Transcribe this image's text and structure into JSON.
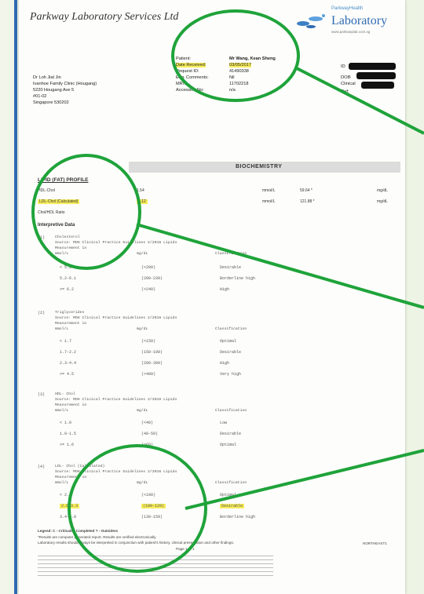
{
  "header": {
    "lab_name": "Parkway Laboratory Services Ltd",
    "logo_small": "ParkwayHealth",
    "logo_big": "Laboratory",
    "logo_url": "www.parkwaylab.com.sg"
  },
  "doctor": {
    "name": "Dr Loh Jiat Jin",
    "clinic": "Ivanhoe Family Clinic (Hougang)",
    "address1": "5220 Hougang Ave 5",
    "address2": "#01-02",
    "address3": "Singapore 530202"
  },
  "patient": {
    "patient_label": "Patient:",
    "patient_value": "Mr Wang, Kean Sheng",
    "received_label": "Date Received:",
    "received_value": "03/05/2017",
    "request_label": "Request ID:",
    "request_value": "41490338",
    "comments_label": "Enq. Comments:",
    "comments_value": "Nil",
    "mrn_label": "MRN:",
    "mrn_value": "11702218",
    "accession_label": "Accession No:",
    "accession_value": "n/a"
  },
  "dob_block": {
    "label1": "ID",
    "label2": "DOB",
    "label3": "Clinical",
    "label4": "Ref:"
  },
  "biochem": {
    "section_title": "BIOCHEMISTRY",
    "panel_title": "LIPID (FAT) PROFILE",
    "rows": [
      {
        "test": "HDL-Chol",
        "value": "1.54",
        "unit": "mmol/L",
        "conv": "59.64 *",
        "conv_unit": "mg/dL"
      },
      {
        "test": "LDL-Chol (Calculated)",
        "value": "3.12",
        "unit": "mmol/L",
        "conv": "121.88 *",
        "conv_unit": "mg/dL"
      },
      {
        "test": "Chol/HDL Ratio",
        "value": "",
        "unit": "",
        "conv": "",
        "conv_unit": ""
      }
    ],
    "interpretive_label": "Interpretive Data"
  },
  "guidelines": [
    {
      "num": "(1)",
      "test": "Cholesterol",
      "source": "Source: MOH Clinical Practice Guidelines 2/2016 Lipids",
      "meas": "Measurement in",
      "unit_header": "mmol/L",
      "mg_header": "mg/dL",
      "cls_header": "Classification",
      "rows": [
        {
          "mmol": "< 5.2",
          "mg": "(<200)",
          "cls": "Desirable"
        },
        {
          "mmol": "5.2-6.1",
          "mg": "(200-239)",
          "cls": "Borderline high"
        },
        {
          "mmol": ">= 6.2",
          "mg": "(>240)",
          "cls": "High"
        }
      ]
    },
    {
      "num": "(2)",
      "test": "Triglycerides",
      "source": "Source: MOH Clinical Practice Guidelines 2/2016 Lipids",
      "meas": "Measurement in",
      "unit_header": "mmol/L",
      "mg_header": "mg/dL",
      "cls_header": "Classification",
      "rows": [
        {
          "mmol": "< 1.7",
          "mg": "(<150)",
          "cls": "Optimal"
        },
        {
          "mmol": "1.7-2.2",
          "mg": "(150-199)",
          "cls": "Desirable"
        },
        {
          "mmol": "2.3-4.4",
          "mg": "(200-399)",
          "cls": "High"
        },
        {
          "mmol": ">= 4.5",
          "mg": "(>400)",
          "cls": "Very high"
        }
      ]
    },
    {
      "num": "(3)",
      "test": "HDL- Chol",
      "source": "Source: MOH Clinical Practice Guidelines 2/2016 Lipids",
      "meas": "Measurement in",
      "unit_header": "mmol/L",
      "mg_header": "mg/dL",
      "cls_header": "Classification",
      "rows": [
        {
          "mmol": "< 1.0",
          "mg": "(<40)",
          "cls": "Low"
        },
        {
          "mmol": "1.0-1.5",
          "mg": "(40-59)",
          "cls": "Desirable"
        },
        {
          "mmol": ">= 1.6",
          "mg": "(>60)",
          "cls": "Optimal"
        }
      ]
    },
    {
      "num": "(4)",
      "test": "LDL- Chol (Calculated)",
      "source": "Source: MOH Clinical Practice Guidelines 2/2016 Lipids",
      "meas": "Measurement in",
      "unit_header": "mmol/L",
      "mg_header": "mg/dL",
      "cls_header": "Classification",
      "rows": [
        {
          "mmol": "< 2.6",
          "mg": "(<100)",
          "cls": "Optimal"
        },
        {
          "mmol": "2.6-3.3",
          "mg": "(100-129)",
          "cls": "Desirable"
        },
        {
          "mmol": "3.4-4.0",
          "mg": "(130-159)",
          "cls": "Borderline high"
        }
      ]
    }
  ],
  "footer": {
    "legend": "Legend: C - Criticals ; Completed ? - Outsiders",
    "note1": "*Results are computer generated report. Results are verified electronically.",
    "note2": "Laboratory results should always be interpreted in conjunction with patient's history, clinical presentation and other findings.",
    "page": "Page 1 of 1",
    "right_code": "NORTHEAST1"
  },
  "annotation_color": "#1fa33a"
}
